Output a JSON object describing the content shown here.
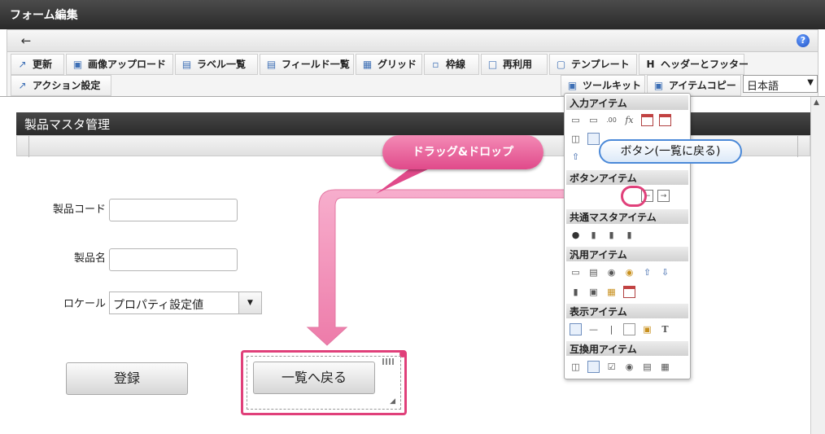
{
  "window": {
    "title": "フォーム編集"
  },
  "toolbar": {
    "row1": [
      {
        "label": "更新",
        "icon": "refresh-icon"
      },
      {
        "label": "画像アップロード",
        "icon": "image-upload-icon"
      },
      {
        "label": "ラベル一覧",
        "icon": "label-list-icon"
      },
      {
        "label": "フィールド一覧",
        "icon": "field-list-icon"
      },
      {
        "label": "グリッド",
        "icon": "grid-icon"
      },
      {
        "label": "枠線",
        "icon": "border-icon"
      },
      {
        "label": "再利用",
        "icon": "reuse-icon"
      },
      {
        "label": "テンプレート",
        "icon": "template-icon"
      },
      {
        "label": "ヘッダーとフッター",
        "icon": "header-footer-icon",
        "glyph": "H"
      }
    ],
    "row2": [
      {
        "label": "アクション設定",
        "icon": "action-icon"
      },
      {
        "label": "ツールキット",
        "icon": "toolkit-icon"
      },
      {
        "label": "アイテムコピー",
        "icon": "item-copy-icon"
      }
    ],
    "language": "日本語"
  },
  "form": {
    "header": "製品マスタ管理",
    "fields": {
      "code_label": "製品コード",
      "name_label": "製品名",
      "locale_label": "ロケール",
      "locale_value": "プロパティ設定値"
    },
    "buttons": {
      "register": "登録",
      "back": "一覧へ戻る"
    }
  },
  "palette": {
    "sections": [
      "入力アイテム",
      "ボタンアイテム",
      "共通マスタアイテム",
      "汎用アイテム",
      "表示アイテム",
      "互換用アイテム"
    ]
  },
  "callouts": {
    "drag": "ドラッグ&ドロップ",
    "button_hint": "ボタン(一覧に戻る)"
  },
  "colors": {
    "accent_pink": "#e0407a",
    "callout_blue": "#4b89d8"
  }
}
